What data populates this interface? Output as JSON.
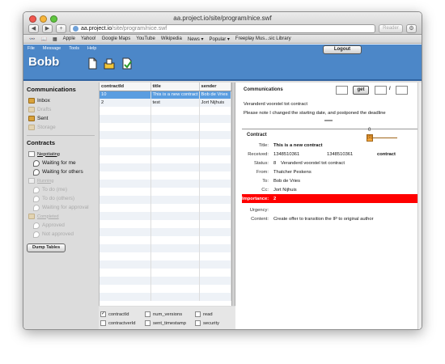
{
  "window": {
    "title": "aa.project.io/site/program/nice.swf",
    "url_host": "aa.project.io",
    "url_path": "/site/program/nice.swf",
    "reader_label": "Reader",
    "nav": {
      "back": "◀",
      "forward": "▶",
      "add": "+"
    }
  },
  "bookmarks": [
    "Apple",
    "Yahoo!",
    "Google Maps",
    "YouTube",
    "Wikipedia",
    "News ▾",
    "Popular ▾",
    "Freeplay Mus...sic Library"
  ],
  "menu": [
    "File",
    "Message",
    "Tools",
    "Help"
  ],
  "app": {
    "logo": "Bobb",
    "logout": "Logout"
  },
  "sidebar": {
    "communications_heading": "Communications",
    "communications": [
      {
        "label": "Inbox",
        "dim": false
      },
      {
        "label": "Drafts",
        "dim": true
      },
      {
        "label": "Sent",
        "dim": false
      },
      {
        "label": "Storage",
        "dim": true
      }
    ],
    "contracts_heading": "Contracts",
    "negotiating": "Negotiating",
    "waiting_for_me": "Waiting for me",
    "waiting_for_others": "Waiting for others",
    "running": "Running",
    "todo_me": "To do (me)",
    "todo_others": "To do (others)",
    "waiting_for_approval": "Waiting for approval",
    "completed": "Completed",
    "approved": "Approved",
    "not_approved": "Not approved",
    "dump_tables": "Dump Tables"
  },
  "table": {
    "headers": [
      "contractId",
      "title",
      "sender"
    ],
    "rows": [
      {
        "contractId": "10",
        "title": "This is a new contract",
        "sender": "Bob de Vries"
      },
      {
        "contractId": "2",
        "title": "test",
        "sender": "Jort Nijhuis"
      }
    ]
  },
  "columns": [
    {
      "label": "contractId",
      "checked": true
    },
    {
      "label": "num_versions",
      "checked": false
    },
    {
      "label": "read",
      "checked": false
    },
    {
      "label": "contractverId",
      "checked": false
    },
    {
      "label": "sent_timestamp",
      "checked": false
    },
    {
      "label": "security",
      "checked": false
    }
  ],
  "communications": {
    "heading": "Communications",
    "get_label": "get",
    "page_sep": "/",
    "message_subject": "Veranderd voorstel tot contract",
    "message_body": "Please note I changed the starting date, and postponed the deadline"
  },
  "contract": {
    "heading": "Contract",
    "slider_value": "0",
    "slider_knob": "[0]",
    "title_label": "Title:",
    "title": "This is a new contract",
    "received_label": "Received:",
    "received_1": "1348510361",
    "received_2": "1348510361",
    "received_extra": "contract",
    "status_label": "Status:",
    "status_num": "8",
    "status_text": "Veranderd voorstel tot contract",
    "from_label": "From:",
    "from": "Thatcher Peskens",
    "to_label": "To:",
    "to": "Bob de Vries",
    "cc_label": "Cc:",
    "cc": "Jort Nijhuis",
    "importance_label": "Importance:",
    "importance": "2",
    "urgency_label": "Urgency:",
    "urgency": "",
    "content_label": "Content:",
    "content": "Create offer to transition the IP to original author"
  },
  "colors": {
    "header_blue": "#4c87c8",
    "selected_row": "#5a9de0",
    "importance_red": "#ff0000"
  }
}
